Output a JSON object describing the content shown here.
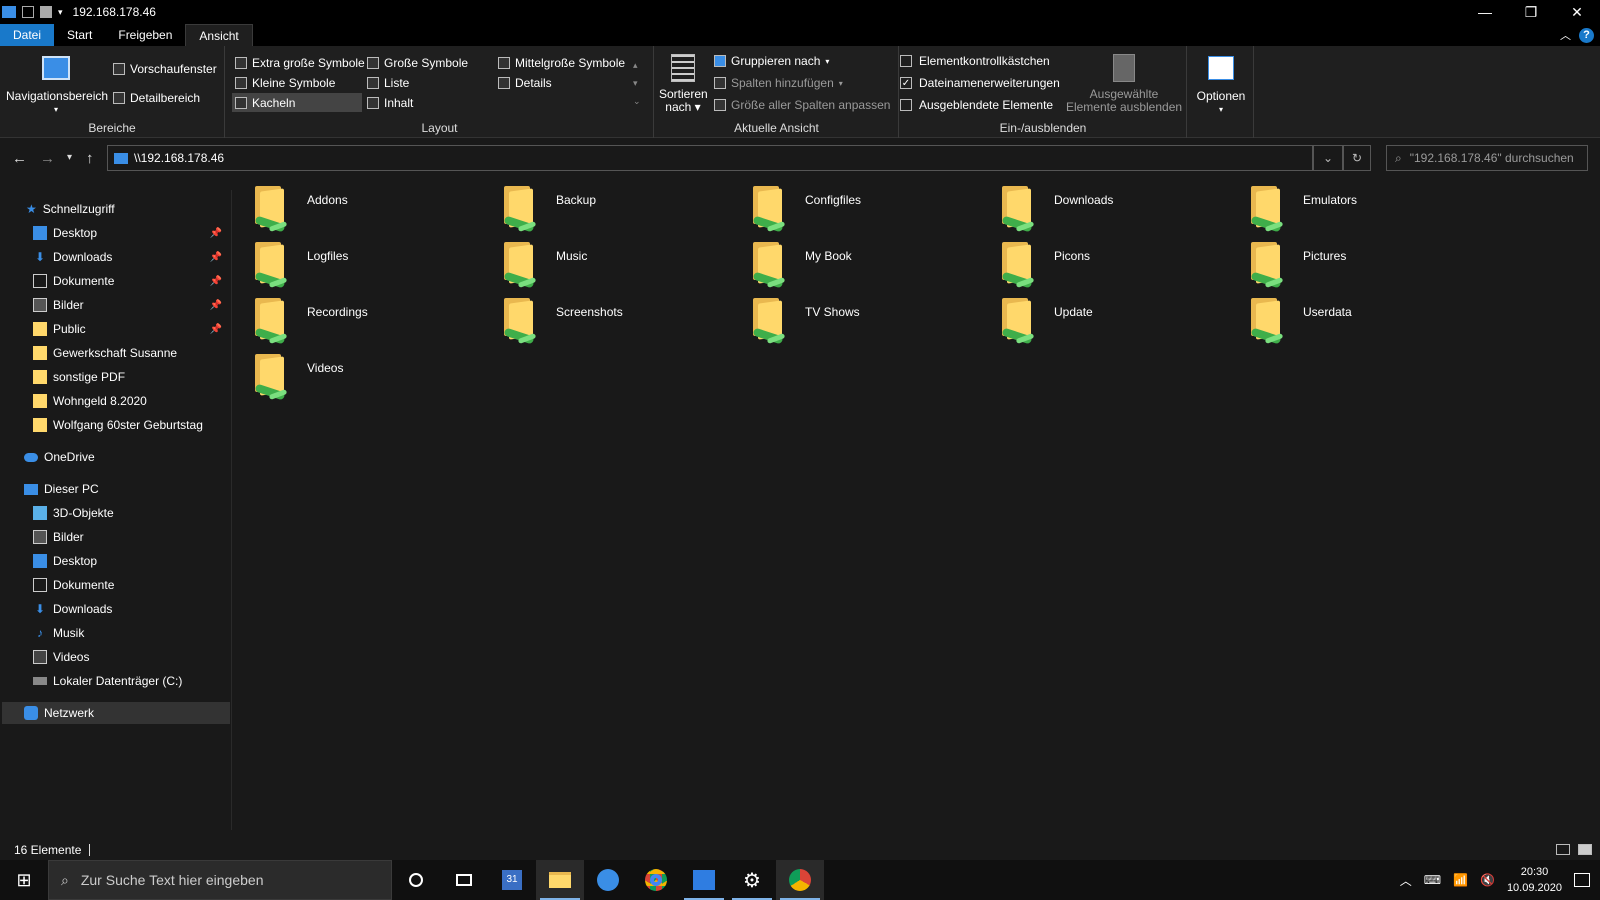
{
  "window": {
    "title": "192.168.178.46",
    "controls": {
      "minimize": "—",
      "maximize": "❐",
      "close": "✕"
    }
  },
  "tabs": [
    {
      "label": "Datei"
    },
    {
      "label": "Start"
    },
    {
      "label": "Freigeben"
    },
    {
      "label": "Ansicht"
    }
  ],
  "ribbon": {
    "bereiche": {
      "navigationsbereich": "Navigationsbereich",
      "vorschaufenster": "Vorschaufenster",
      "detailbereich": "Detailbereich",
      "label": "Bereiche"
    },
    "layout": {
      "items": [
        "Extra große Symbole",
        "Große Symbole",
        "Mittelgroße Symbole",
        "Kleine Symbole",
        "Liste",
        "Details",
        "Kacheln",
        "Inhalt"
      ],
      "label": "Layout"
    },
    "aktuelle_ansicht": {
      "sortieren": "Sortieren",
      "nach": "nach",
      "gruppieren": "Gruppieren nach",
      "spalten": "Spalten hinzufügen",
      "groesse": "Größe aller Spalten anpassen",
      "label": "Aktuelle Ansicht"
    },
    "ein_aus": {
      "elementkontroll": "Elementkontrollkästchen",
      "dateinamen": "Dateinamenerweiterungen",
      "ausgeblendete": "Ausgeblendete Elemente",
      "ausgewaehlte_1": "Ausgewählte",
      "ausgewaehlte_2": "Elemente ausblenden",
      "label": "Ein-/ausblenden"
    },
    "optionen": "Optionen"
  },
  "address": {
    "path": "\\\\192.168.178.46",
    "search_placeholder": "\"192.168.178.46\" durchsuchen"
  },
  "sidebar": {
    "schnellzugriff": "Schnellzugriff",
    "quick": [
      {
        "label": "Desktop",
        "pinned": true
      },
      {
        "label": "Downloads",
        "pinned": true
      },
      {
        "label": "Dokumente",
        "pinned": true
      },
      {
        "label": "Bilder",
        "pinned": true
      },
      {
        "label": "Public",
        "pinned": true
      },
      {
        "label": "Gewerkschaft Susanne"
      },
      {
        "label": "sonstige PDF"
      },
      {
        "label": "Wohngeld 8.2020"
      },
      {
        "label": "Wolfgang 60ster Geburtstag"
      }
    ],
    "onedrive": "OneDrive",
    "dieser_pc": "Dieser PC",
    "pc": [
      {
        "label": "3D-Objekte"
      },
      {
        "label": "Bilder"
      },
      {
        "label": "Desktop"
      },
      {
        "label": "Dokumente"
      },
      {
        "label": "Downloads"
      },
      {
        "label": "Musik"
      },
      {
        "label": "Videos"
      },
      {
        "label": "Lokaler Datenträger (C:)"
      }
    ],
    "netzwerk": "Netzwerk"
  },
  "folders": [
    "Addons",
    "Backup",
    "Configfiles",
    "Downloads",
    "Emulators",
    "Logfiles",
    "Music",
    "My Book",
    "Picons",
    "Pictures",
    "Recordings",
    "Screenshots",
    "TV Shows",
    "Update",
    "Userdata",
    "Videos"
  ],
  "status": {
    "count": "16 Elemente"
  },
  "taskbar": {
    "search_placeholder": "Zur Suche Text hier eingeben",
    "time": "20:30",
    "date": "10.09.2020",
    "calendar_day": "31"
  },
  "colors": {
    "accent": "#1979ca",
    "folder": "#ffd86b",
    "cable": "#3fae4a"
  }
}
